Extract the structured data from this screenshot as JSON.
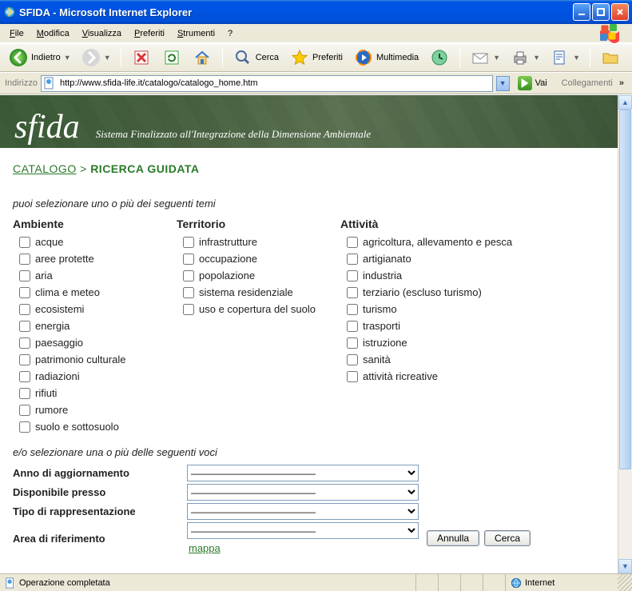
{
  "window": {
    "title": "SFIDA - Microsoft Internet Explorer"
  },
  "menu": {
    "file": "File",
    "file_u": "F",
    "modifica": "Modifica",
    "modifica_u": "M",
    "visualizza": "Visualizza",
    "visualizza_u": "V",
    "preferiti": "Preferiti",
    "preferiti_u": "P",
    "strumenti": "Strumenti",
    "strumenti_u": "S",
    "help": "?"
  },
  "toolbar": {
    "back": "Indietro",
    "search": "Cerca",
    "favorites": "Preferiti",
    "media": "Multimedia"
  },
  "address": {
    "label": "Indirizzo",
    "url": "http://www.sfida-life.it/catalogo/catalogo_home.htm",
    "go": "Vai",
    "links": "Collegamenti"
  },
  "banner": {
    "logo": "sfida",
    "tagline": "Sistema Finalizzato all'Integrazione della Dimensione Ambientale"
  },
  "page": {
    "bc_catalogo": "CATALOGO",
    "bc_sep": ">",
    "bc_current": "RICERCA GUIDATA",
    "intro1": "puoi selezionare uno o più dei seguenti temi",
    "intro2": "e/o selezionare una o più delle seguenti voci",
    "col_ambiente": "Ambiente",
    "col_territorio": "Territorio",
    "col_attivita": "Attività",
    "ambiente": [
      "acque",
      "aree protette",
      "aria",
      "clima e meteo",
      "ecosistemi",
      "energia",
      "paesaggio",
      "patrimonio culturale",
      "radiazioni",
      "rifiuti",
      "rumore",
      "suolo e sottosuolo"
    ],
    "territorio": [
      "infrastrutture",
      "occupazione",
      "popolazione",
      "sistema residenziale",
      "uso e copertura del suolo"
    ],
    "attivita": [
      "agricoltura, allevamento e pesca",
      "artigianato",
      "industria",
      "terziario (escluso turismo)",
      "turismo",
      "trasporti",
      "istruzione",
      "sanità",
      "attività ricreative"
    ],
    "labels": {
      "anno": "Anno di aggiornamento",
      "disp": "Disponibile presso",
      "tipo": "Tipo di rappresentazione",
      "area": "Area di riferimento",
      "mappa": "mappa"
    },
    "select_placeholder": "—————————————",
    "btn_annulla": "Annulla",
    "btn_cerca": "Cerca"
  },
  "status": {
    "done": "Operazione completata",
    "zone": "Internet"
  }
}
